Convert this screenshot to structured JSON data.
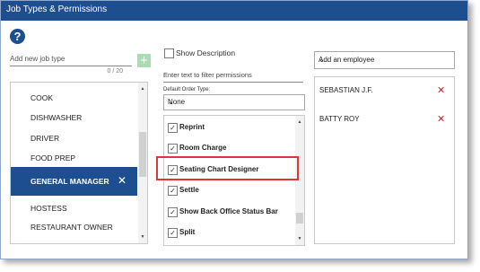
{
  "window": {
    "title": "Job Types & Permissions"
  },
  "help": {
    "icon": "help-icon",
    "glyph": "?"
  },
  "new_job": {
    "placeholder": "Add new job type",
    "char_count": "0 / 20",
    "add_glyph": "+"
  },
  "job_types": {
    "items": [
      {
        "label": "COOK"
      },
      {
        "label": "DISHWASHER"
      },
      {
        "label": "DRIVER"
      },
      {
        "label": "FOOD PREP"
      },
      {
        "label": "GENERAL MANAGER",
        "selected": true
      },
      {
        "label": "HOSTESS"
      },
      {
        "label": "RESTAURANT OWNER"
      }
    ],
    "remove_glyph": "✕"
  },
  "permissions": {
    "show_description_label": "Show Description",
    "show_description_checked": false,
    "filter_placeholder": "Enter text to filter permissions",
    "order_type_label": "Default Order Type:",
    "order_type_value": "None",
    "items": [
      {
        "label": "Reprint",
        "checked": true
      },
      {
        "label": "Room Charge",
        "checked": true
      },
      {
        "label": "Seating Chart Designer",
        "checked": true
      },
      {
        "label": "Settle",
        "checked": true
      },
      {
        "label": "Show Back Office Status Bar",
        "checked": true
      },
      {
        "label": "Split",
        "checked": true
      }
    ]
  },
  "employees": {
    "add_placeholder": "Add an employee",
    "items": [
      {
        "name": "SEBASTIAN J.F."
      },
      {
        "name": "BATTY ROY"
      }
    ],
    "remove_glyph": "✕"
  },
  "colors": {
    "title_bar": "#1d4e8f",
    "selected_row": "#1d4e8f",
    "add_button": "#a9dcb1",
    "remove_x": "#c62828",
    "highlight_box": "#e0353a"
  },
  "glyphs": {
    "check": "✓",
    "chevron_down": "⌄",
    "scroll_up": "▲",
    "scroll_down": "▼"
  }
}
